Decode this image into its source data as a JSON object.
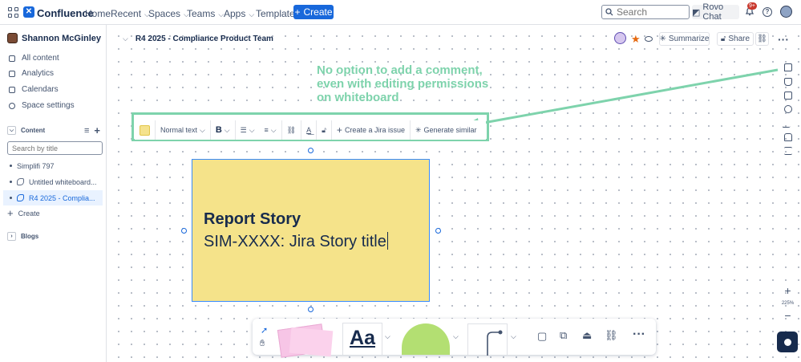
{
  "topnav": {
    "brand": "Confluence",
    "recent": "Recent",
    "spaces": "Spaces",
    "teams": "Teams",
    "apps": "Apps",
    "templates": "Templates",
    "create": "Create",
    "search_placeholder": "Search",
    "rovo_chat": "Rovo Chat",
    "notifications_badge": "9+"
  },
  "sidebar": {
    "space_name": "Shannon McGinley",
    "items": [
      {
        "label": "All content",
        "icon": "list-icon"
      },
      {
        "label": "Analytics",
        "icon": "chart-icon"
      },
      {
        "label": "Calendars",
        "icon": "calendar-icon"
      },
      {
        "label": "Space settings",
        "icon": "gear-icon"
      }
    ],
    "content_header": "Content",
    "search_placeholder": "Search by title",
    "tree": [
      {
        "label": "Simplifi 797",
        "type": "page"
      },
      {
        "label": "Untitled whiteboard...",
        "type": "whiteboard"
      },
      {
        "label": "R4 2025 - Complia...",
        "type": "whiteboard",
        "selected": true
      }
    ],
    "create_label": "Create",
    "blogs_header": "Blogs"
  },
  "header": {
    "breadcrumb": "R4 2025 - Compliance Product Team",
    "summarize": "Summarize",
    "share": "Share"
  },
  "annotation": {
    "text": "No option to add a comment, even with editing permissions on whiteboard",
    "color": "#7ed3ac"
  },
  "toolbar": {
    "text_style": "Normal text",
    "create_jira": "Create a Jira issue",
    "generate_similar": "Generate similar"
  },
  "sticky": {
    "title": "Report Story",
    "subtitle": "SIM-XXXX: Jira Story title",
    "color": "#f5e38a"
  },
  "zoom": {
    "level": "225%"
  },
  "bottom_toolbar": {
    "text_tool": "Aa"
  }
}
